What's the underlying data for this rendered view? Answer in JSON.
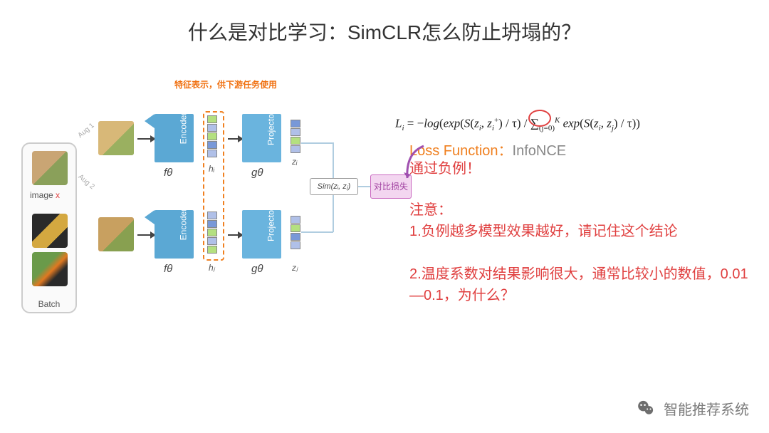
{
  "title": "什么是对比学习：SimCLR怎么防止坍塌的？",
  "diagram": {
    "batch_label": "Batch",
    "image_x": "image",
    "image_x_suffix": "x",
    "aug1": "Aug 1",
    "aug2": "Aug 2",
    "encoder": "Encoder",
    "f_theta": "fθ",
    "feature_note": "特征表示，供下游任务使用",
    "h_i": "hᵢ",
    "h_j": "hⱼ",
    "projector": "Projector",
    "g_theta": "gθ",
    "z_i": "zᵢ",
    "z_j": "zⱼ",
    "sim": "Sim(zᵢ, zⱼ)",
    "loss_box": "对比损失"
  },
  "formula": "Lᵢ = −log(exp(S(zᵢ, zᵢ⁺) / τ) / ∑_(j=0)^K exp(S(zᵢ, zⱼ) / τ))",
  "loss_function": {
    "label": "Loss Function：",
    "name": "InfoNCE"
  },
  "notes": {
    "via_negatives": "通过负例！",
    "attention": "注意：",
    "point1": "1.负例越多模型效果越好，请记住这个结论",
    "point2": "2.温度系数对结果影响很大，通常比较小的数值，0.01—0.1，为什么？"
  },
  "brand": "智能推荐系统"
}
